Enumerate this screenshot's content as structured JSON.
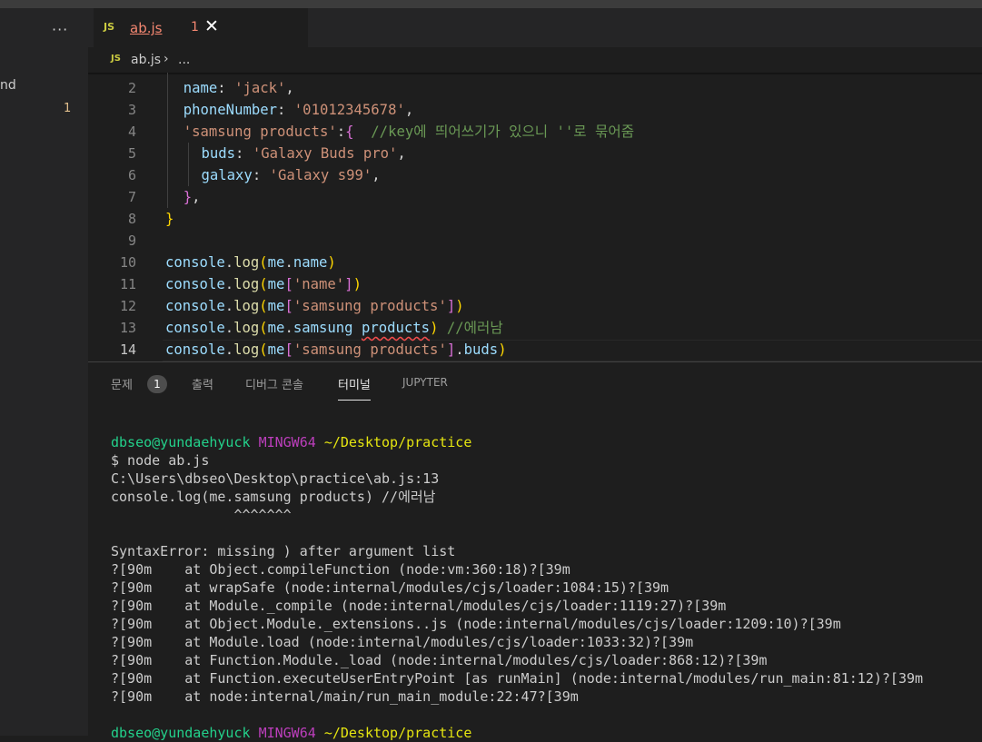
{
  "sidebar": {
    "more": "···",
    "fragment": "nd",
    "count": "1"
  },
  "tab": {
    "badge": "JS",
    "filename": "ab.js",
    "problem_count": "1",
    "close": "✕"
  },
  "breadcrumb": {
    "badge": "JS",
    "filename": "ab.js",
    "separator": "›",
    "ellipsis": "..."
  },
  "editor": {
    "lines": [
      {
        "num": "2",
        "code": "name: 'jack',"
      },
      {
        "num": "3",
        "code": "phoneNumber: '01012345678',"
      },
      {
        "num": "4",
        "code": "'samsung products':{  //key에 띄어쓰기가 있으니 ''로 묶어줌"
      },
      {
        "num": "5",
        "code": "buds: 'Galaxy Buds pro',"
      },
      {
        "num": "6",
        "code": "galaxy: 'Galaxy s99',"
      },
      {
        "num": "7",
        "code": "},"
      },
      {
        "num": "8",
        "code": "}"
      },
      {
        "num": "9",
        "code": ""
      },
      {
        "num": "10",
        "code": "console.log(me.name)"
      },
      {
        "num": "11",
        "code": "console.log(me['name'])"
      },
      {
        "num": "12",
        "code": "console.log(me['samsung products'])"
      },
      {
        "num": "13",
        "code": "console.log(me.samsung products) //에러남"
      },
      {
        "num": "14",
        "code": "console.log(me['samsung products'].buds)"
      }
    ]
  },
  "panel": {
    "tabs": [
      "문제",
      "출력",
      "디버그 콘솔",
      "터미널",
      "JUPYTER"
    ],
    "problems_badge": "1",
    "active_tab": "터미널"
  },
  "terminal": {
    "prompt_user": "dbseo@yundaehyuck",
    "prompt_env": "MINGW64",
    "prompt_path": "~/Desktop/practice",
    "lines": [
      "$ node ab.js",
      "C:\\Users\\dbseo\\Desktop\\practice\\ab.js:13",
      "console.log(me.samsung products) //에러남",
      "               ^^^^^^^",
      "",
      "SyntaxError: missing ) after argument list",
      "?[90m    at Object.compileFunction (node:vm:360:18)?[39m",
      "?[90m    at wrapSafe (node:internal/modules/cjs/loader:1084:15)?[39m",
      "?[90m    at Module._compile (node:internal/modules/cjs/loader:1119:27)?[39m",
      "?[90m    at Object.Module._extensions..js (node:internal/modules/cjs/loader:1209:10)?[39m",
      "?[90m    at Module.load (node:internal/modules/cjs/loader:1033:32)?[39m",
      "?[90m    at Function.Module._load (node:internal/modules/cjs/loader:868:12)?[39m",
      "?[90m    at Function.executeUserEntryPoint [as runMain] (node:internal/modules/run_main:81:12)?[39m",
      "?[90m    at node:internal/main/run_main_module:22:47?[39m",
      ""
    ]
  },
  "colors": {
    "editor_bg": "#1e1e1e",
    "sidebar_bg": "#252526",
    "error_text": "#f48771",
    "terminal_green": "#23d18b",
    "terminal_magenta": "#bc3fbc",
    "terminal_yellow": "#e5e510"
  }
}
